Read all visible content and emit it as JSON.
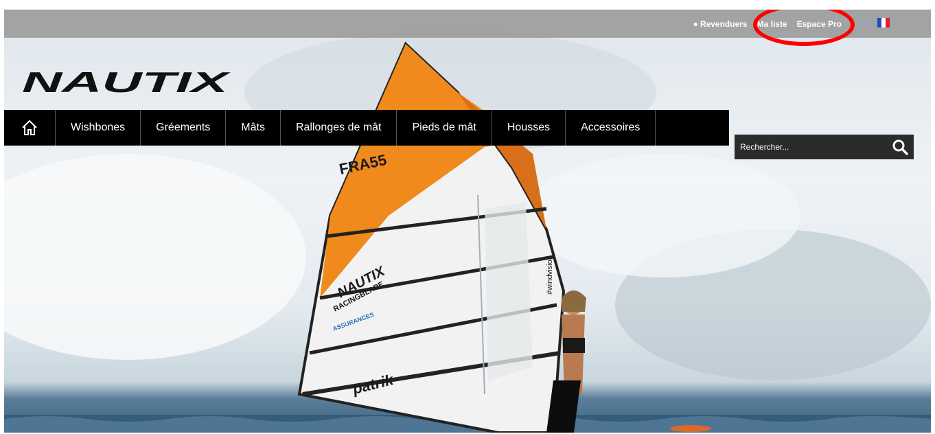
{
  "topbar": {
    "links": [
      {
        "label": "Revenduers",
        "icon": "map-pin-icon"
      },
      {
        "label": "Ma liste"
      },
      {
        "label": "Espace Pro"
      }
    ],
    "languages": [
      "english-flag-icon",
      "french-flag-icon"
    ]
  },
  "brand": {
    "logo": "NAUTIX"
  },
  "nav": {
    "home_icon": "home-icon",
    "items": [
      "Wishbones",
      "Gréements",
      "Mâts",
      "Rallonges de mât",
      "Pieds de mât",
      "Housses",
      "Accessoires"
    ]
  },
  "search": {
    "placeholder": "Rechercher...",
    "icon": "search-icon"
  },
  "sail": {
    "number": "FRA55",
    "brand": "NAUTIX",
    "model": "RACINGBLADE",
    "sponsor": "ASSURANCES",
    "signature": "patrik",
    "side": "#windvision"
  },
  "colors": {
    "nav_bg": "#000000",
    "topbar_bg": "#969696",
    "sail_orange": "#f08a1c",
    "highlight": "#ff0000"
  }
}
